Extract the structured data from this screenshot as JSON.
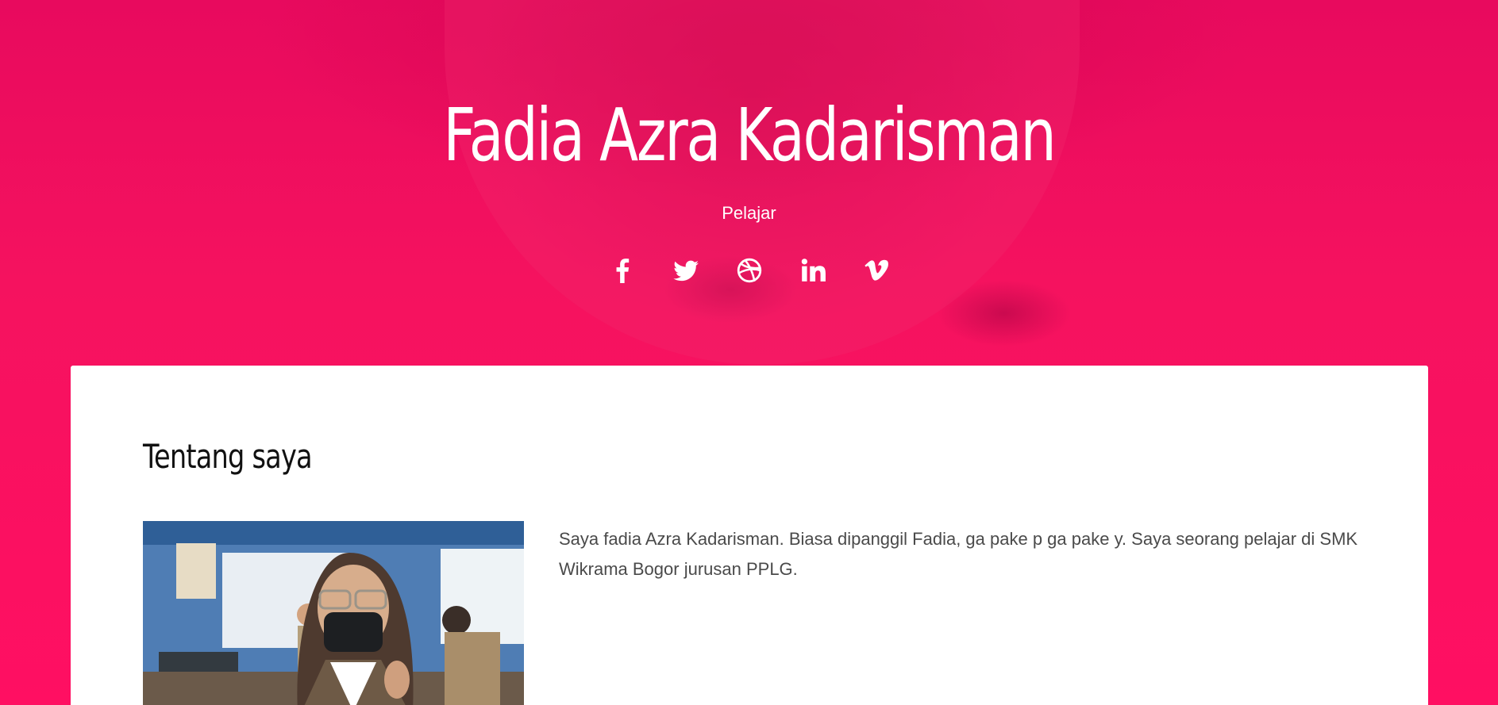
{
  "hero": {
    "name": "Fadia Azra Kadarisman",
    "role": "Pelajar",
    "social_icons": [
      "facebook-icon",
      "twitter-icon",
      "dribbble-icon",
      "linkedin-icon",
      "vimeo-icon"
    ]
  },
  "about": {
    "title": "Tentang saya",
    "text": "Saya fadia Azra Kadarisman. Biasa dipanggil Fadia, ga pake p ga pake y. Saya seorang pelajar di SMK Wikrama Bogor jurusan PPLG."
  },
  "colors": {
    "accent": "#ff0f62",
    "card": "#ffffff",
    "body_text": "#4a4a4a"
  }
}
